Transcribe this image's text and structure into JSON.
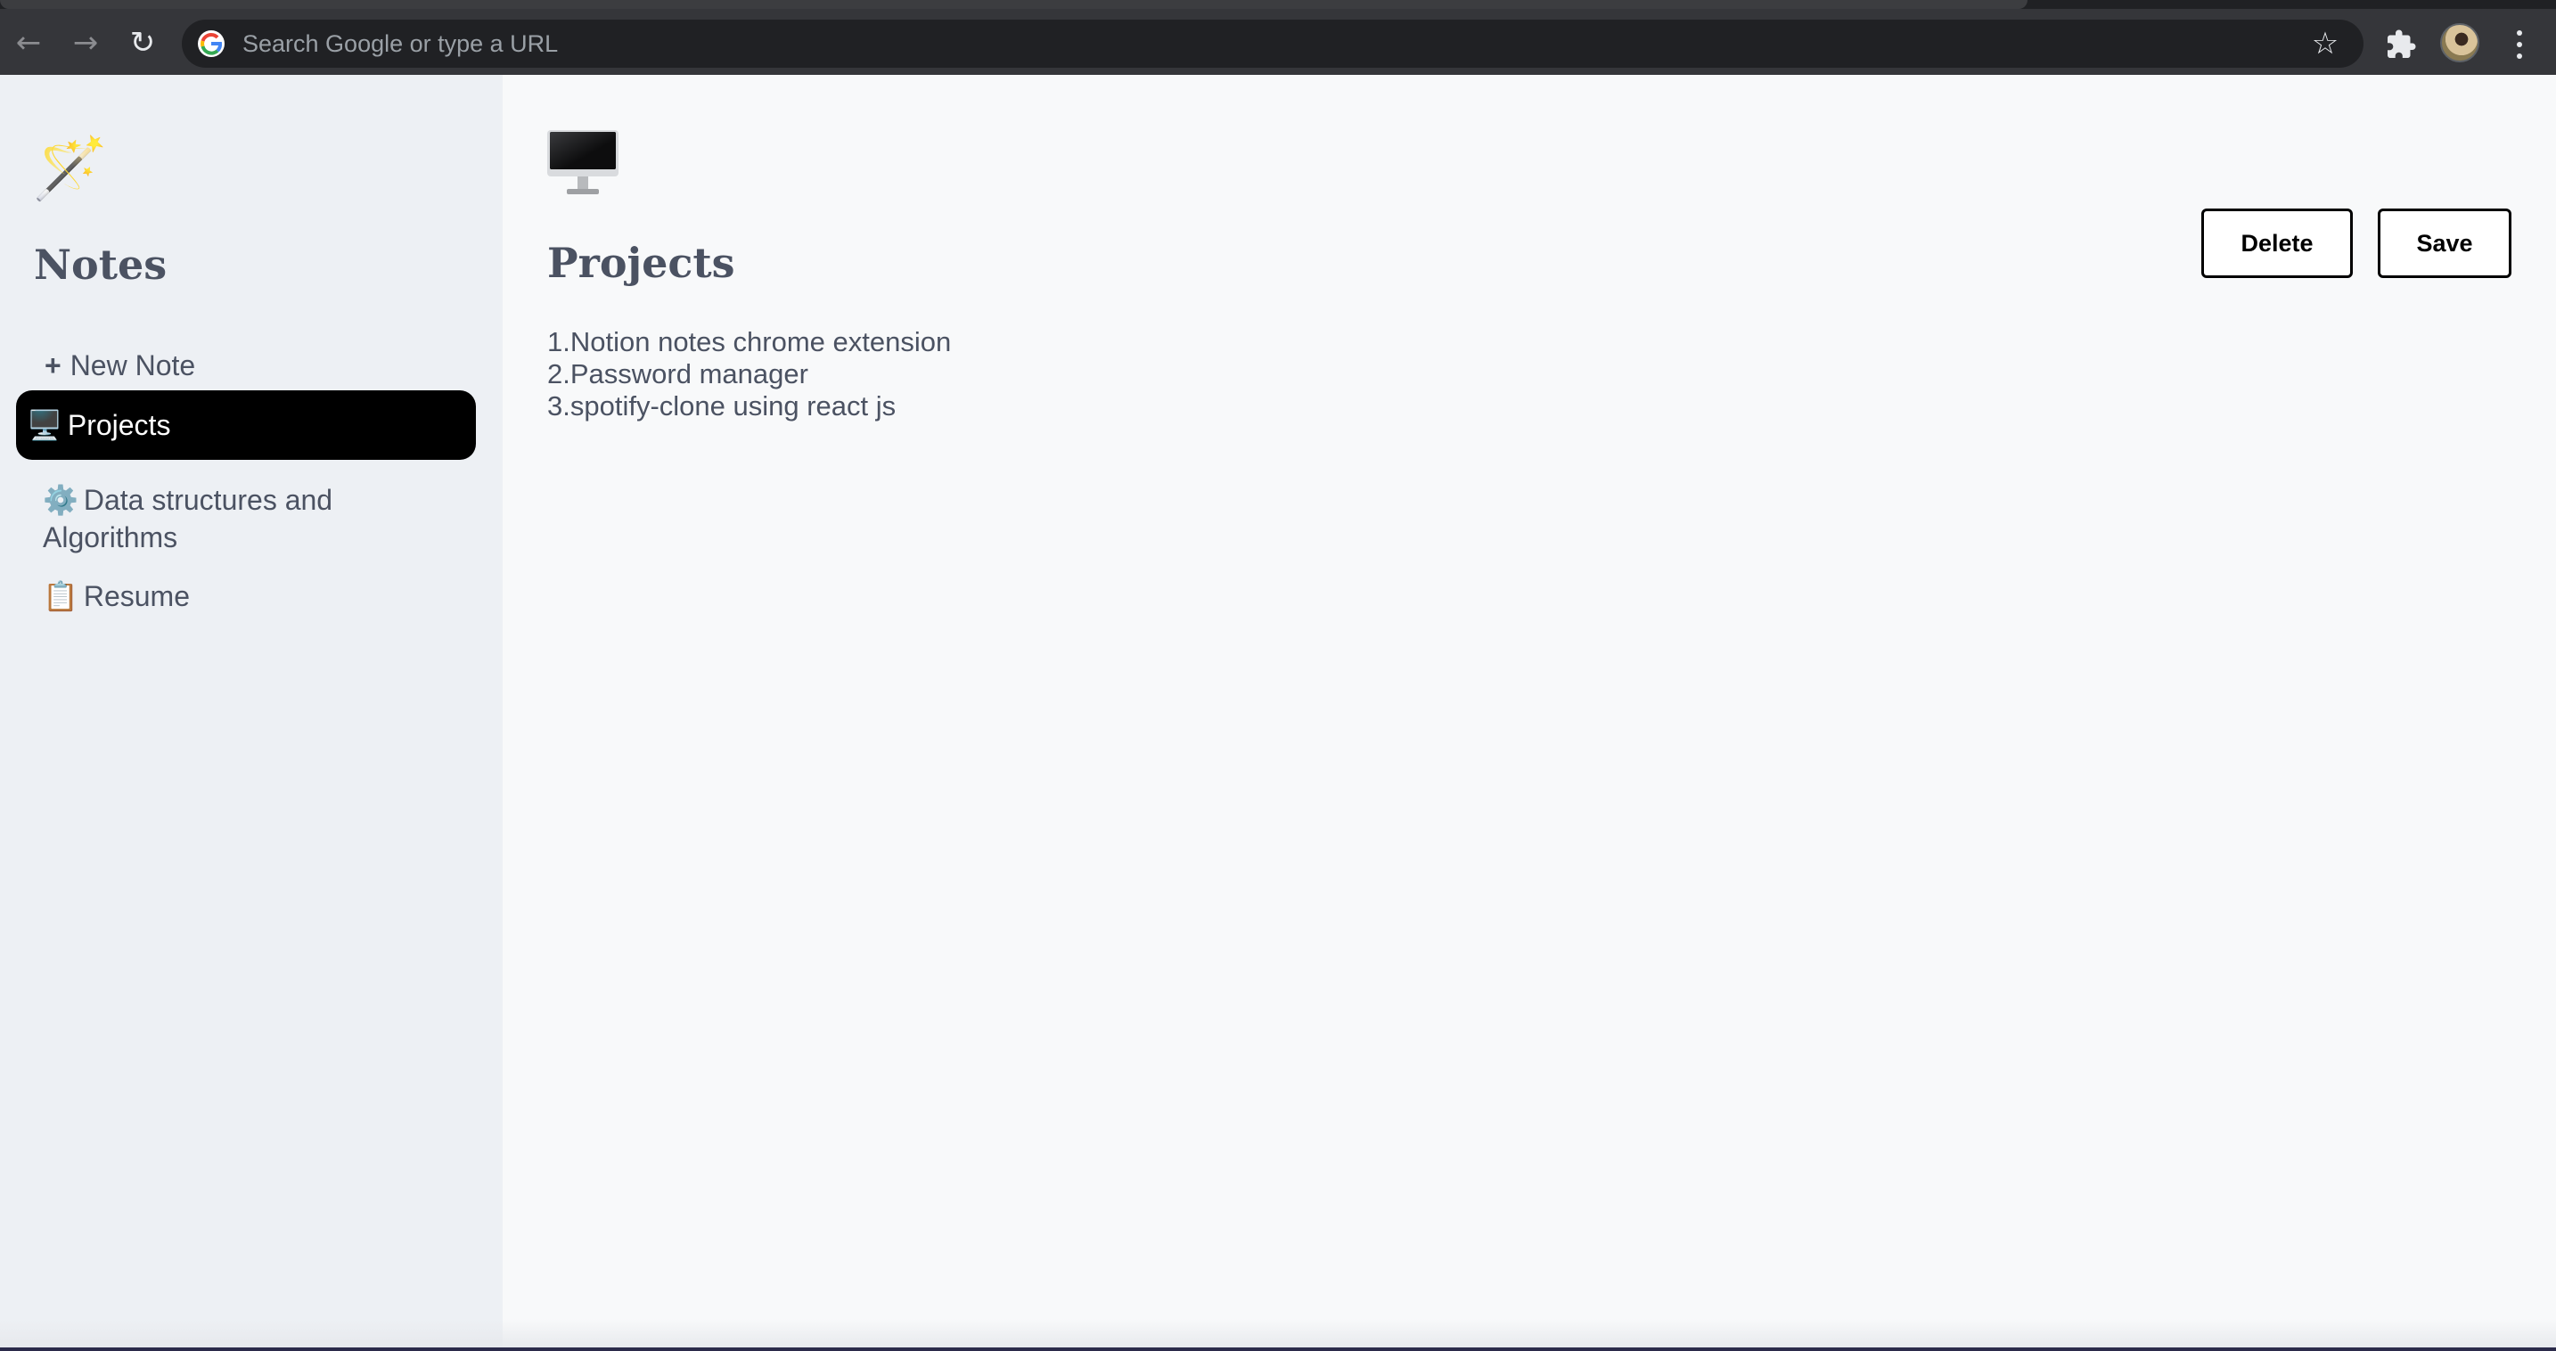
{
  "browser": {
    "omnibox_placeholder": "Search Google or type a URL",
    "icons": [
      "back-arrow-icon",
      "forward-arrow-icon",
      "reload-icon",
      "google-icon",
      "star-icon",
      "extensions-icon",
      "profile-avatar",
      "menu-icon"
    ]
  },
  "sidebar": {
    "logo_icon": "🪄",
    "title": "Notes",
    "new_note_label": "New Note",
    "items": [
      {
        "emoji": "🖥️",
        "label": "Projects",
        "active": true
      },
      {
        "emoji": "⚙️",
        "label": "Data structures and Algorithms",
        "active": false
      },
      {
        "emoji": "📋",
        "label": "Resume",
        "active": false
      }
    ]
  },
  "note": {
    "icon": "desktop-computer",
    "title": "Projects",
    "lines": [
      "1.Notion notes chrome extension",
      "2.Password manager",
      "3.spotify-clone using react js"
    ]
  },
  "actions": {
    "delete_label": "Delete",
    "save_label": "Save"
  },
  "colors": {
    "sidebar_bg": "#edf0f4",
    "page_bg": "#f8f9fa",
    "text": "#4b5262",
    "active_item_bg": "#000000"
  }
}
